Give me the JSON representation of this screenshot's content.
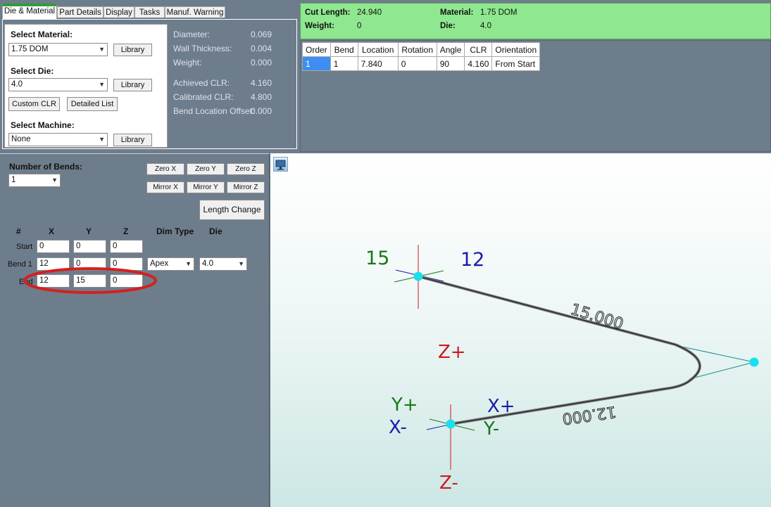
{
  "tabs": [
    "Die & Material",
    "Part Details",
    "Display",
    "Tasks",
    "Manuf. Warning"
  ],
  "material": {
    "select_material_label": "Select Material:",
    "material_value": "1.75 DOM",
    "library_label": "Library",
    "select_die_label": "Select Die:",
    "die_value": "4.0",
    "custom_clr_label": "Custom CLR",
    "detailed_list_label": "Detailed List",
    "select_machine_label": "Select Machine:",
    "machine_value": "None"
  },
  "specs": [
    {
      "label": "Diameter:",
      "value": "0.069"
    },
    {
      "label": "Wall Thickness:",
      "value": "0.004"
    },
    {
      "label": "Weight:",
      "value": "0.000"
    },
    {
      "label": "Achieved CLR:",
      "value": "4.160"
    },
    {
      "label": "Calibrated CLR:",
      "value": "4.800"
    },
    {
      "label": "Bend Location Offset:",
      "value": "0.000"
    }
  ],
  "summary": {
    "cut_length_label": "Cut Length:",
    "cut_length_value": "24.940",
    "weight_label": "Weight:",
    "weight_value": "0",
    "material_label": "Material:",
    "material_value": "1.75 DOM",
    "die_label": "Die:",
    "die_value": "4.0"
  },
  "bend_table": {
    "headers": [
      "Order",
      "Bend",
      "Location",
      "Rotation",
      "Angle",
      "CLR",
      "Orientation"
    ],
    "rows": [
      [
        "1",
        "1",
        "7.840",
        "0",
        "90",
        "4.160",
        "From Start"
      ]
    ]
  },
  "bends_editor": {
    "number_of_bends_label": "Number of Bends:",
    "number_of_bends_value": "1",
    "zero_x": "Zero X",
    "zero_y": "Zero Y",
    "zero_z": "Zero Z",
    "mirror_x": "Mirror X",
    "mirror_y": "Mirror Y",
    "mirror_z": "Mirror Z",
    "length_change": "Length Change",
    "columns": [
      "#",
      "X",
      "Y",
      "Z",
      "Dim Type",
      "Die"
    ],
    "start": {
      "label": "Start",
      "x": "0",
      "y": "0",
      "z": "0"
    },
    "bend1": {
      "label": "Bend 1",
      "x": "12",
      "y": "0",
      "z": "0",
      "dim_type": "Apex",
      "die": "4.0"
    },
    "end": {
      "label": "End",
      "x": "12",
      "y": "15",
      "z": "0"
    }
  },
  "viewer": {
    "label_15": "15",
    "label_12": "12",
    "z_plus": "Z+",
    "z_minus": "Z-",
    "y_plus": "Y+",
    "y_minus": "Y-",
    "x_plus": "X+",
    "x_minus": "X-",
    "dim_upper": "15.000",
    "dim_lower": "12.000",
    "colors": {
      "green": "#157a15",
      "blue": "#1a1aa8",
      "red": "#cc1a1a",
      "cyan": "#18e0ec"
    }
  },
  "highlight_color": "#d42020",
  "summary_bg": "#8fe88f"
}
